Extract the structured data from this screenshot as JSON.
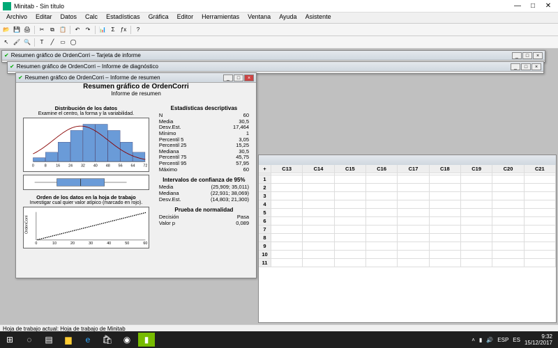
{
  "app": {
    "title": "Minitab - Sin título"
  },
  "menu": [
    "Archivo",
    "Editar",
    "Datos",
    "Calc",
    "Estadísticas",
    "Gráfica",
    "Editor",
    "Herramientas",
    "Ventana",
    "Ayuda",
    "Asistente"
  ],
  "mdi": {
    "back1": "Resumen gráfico de OrdenCorri – Tarjeta de informe",
    "back2": "Resumen gráfico de OrdenCorri – Informe de diagnóstico",
    "front": "Resumen gráfico de OrdenCorri – Informe de resumen"
  },
  "report": {
    "title": "Resumen gráfico de OrdenCorri",
    "subtitle": "Informe de resumen",
    "dist_title": "Distribución de los datos",
    "dist_sub": "Examine el centro, la forma y la variabilidad.",
    "order_title": "Orden de los datos en la hoja de trabajo",
    "order_sub": "Investigar cual quier valor atípico (marcado en rojo).",
    "order_ylabel": "OrdenCorri"
  },
  "stats": {
    "desc_h": "Estadísticas descriptivas",
    "desc": [
      [
        "N",
        "60"
      ],
      [
        "Media",
        "30,5"
      ],
      [
        "Desv.Est.",
        "17,464"
      ],
      [
        "Mínimo",
        "1"
      ],
      [
        "Percentil 5",
        "3,05"
      ],
      [
        "Percentil 25",
        "15,25"
      ],
      [
        "Mediana",
        "30,5"
      ],
      [
        "Percentil 75",
        "45,75"
      ],
      [
        "Percentil 95",
        "57,95"
      ],
      [
        "Máximo",
        "60"
      ]
    ],
    "ci_h": "Intervalos de confianza de 95%",
    "ci": [
      [
        "Media",
        "(25,909; 35,011)"
      ],
      [
        "Mediana",
        "(22,931; 38,069)"
      ],
      [
        "Desv.Est.",
        "(14,803; 21,300)"
      ]
    ],
    "norm_h": "Prueba de normalidad",
    "norm": [
      [
        "Decisión",
        "Pasa"
      ],
      [
        "Valor p",
        "0,089"
      ]
    ]
  },
  "chart_data": [
    {
      "type": "bar",
      "title": "Distribución de los datos",
      "x": [
        0,
        8,
        16,
        24,
        32,
        40,
        48,
        56,
        64,
        72
      ],
      "categories": [
        4,
        12,
        20,
        28,
        36,
        44,
        52,
        60,
        68
      ],
      "values": [
        0.005,
        0.012,
        0.025,
        0.04,
        0.048,
        0.048,
        0.04,
        0.025,
        0.012
      ],
      "overlay_curve": {
        "type": "normal",
        "mean": 30.5,
        "sd": 17.464
      },
      "xlim": [
        0,
        72
      ]
    },
    {
      "type": "boxplot",
      "q1": 15.25,
      "median": 30.5,
      "q3": 45.75,
      "whisker_low": 1,
      "whisker_high": 60,
      "xlim": [
        0,
        72
      ]
    },
    {
      "type": "scatter",
      "title": "Orden de los datos en la hoja de trabajo",
      "x": [
        0,
        5,
        10,
        15,
        20,
        25,
        30,
        35,
        40,
        45,
        50,
        55,
        60
      ],
      "y": [
        1,
        5,
        10,
        15,
        20,
        25,
        30,
        35,
        40,
        45,
        50,
        55,
        60
      ],
      "xlabel": "",
      "ylabel": "OrdenCorri",
      "xlim": [
        0,
        60
      ],
      "ylim": [
        0,
        60
      ]
    }
  ],
  "worksheet_cols": [
    "C13",
    "C14",
    "C15",
    "C16",
    "C17",
    "C18",
    "C19",
    "C20",
    "C21"
  ],
  "statusbar": "Hoja de trabajo actual: Hoja de trabajo de Minitab",
  "taskbar": {
    "lang": "ESP",
    "kb": "ES",
    "time": "9:32",
    "date": "15/12/2017"
  }
}
